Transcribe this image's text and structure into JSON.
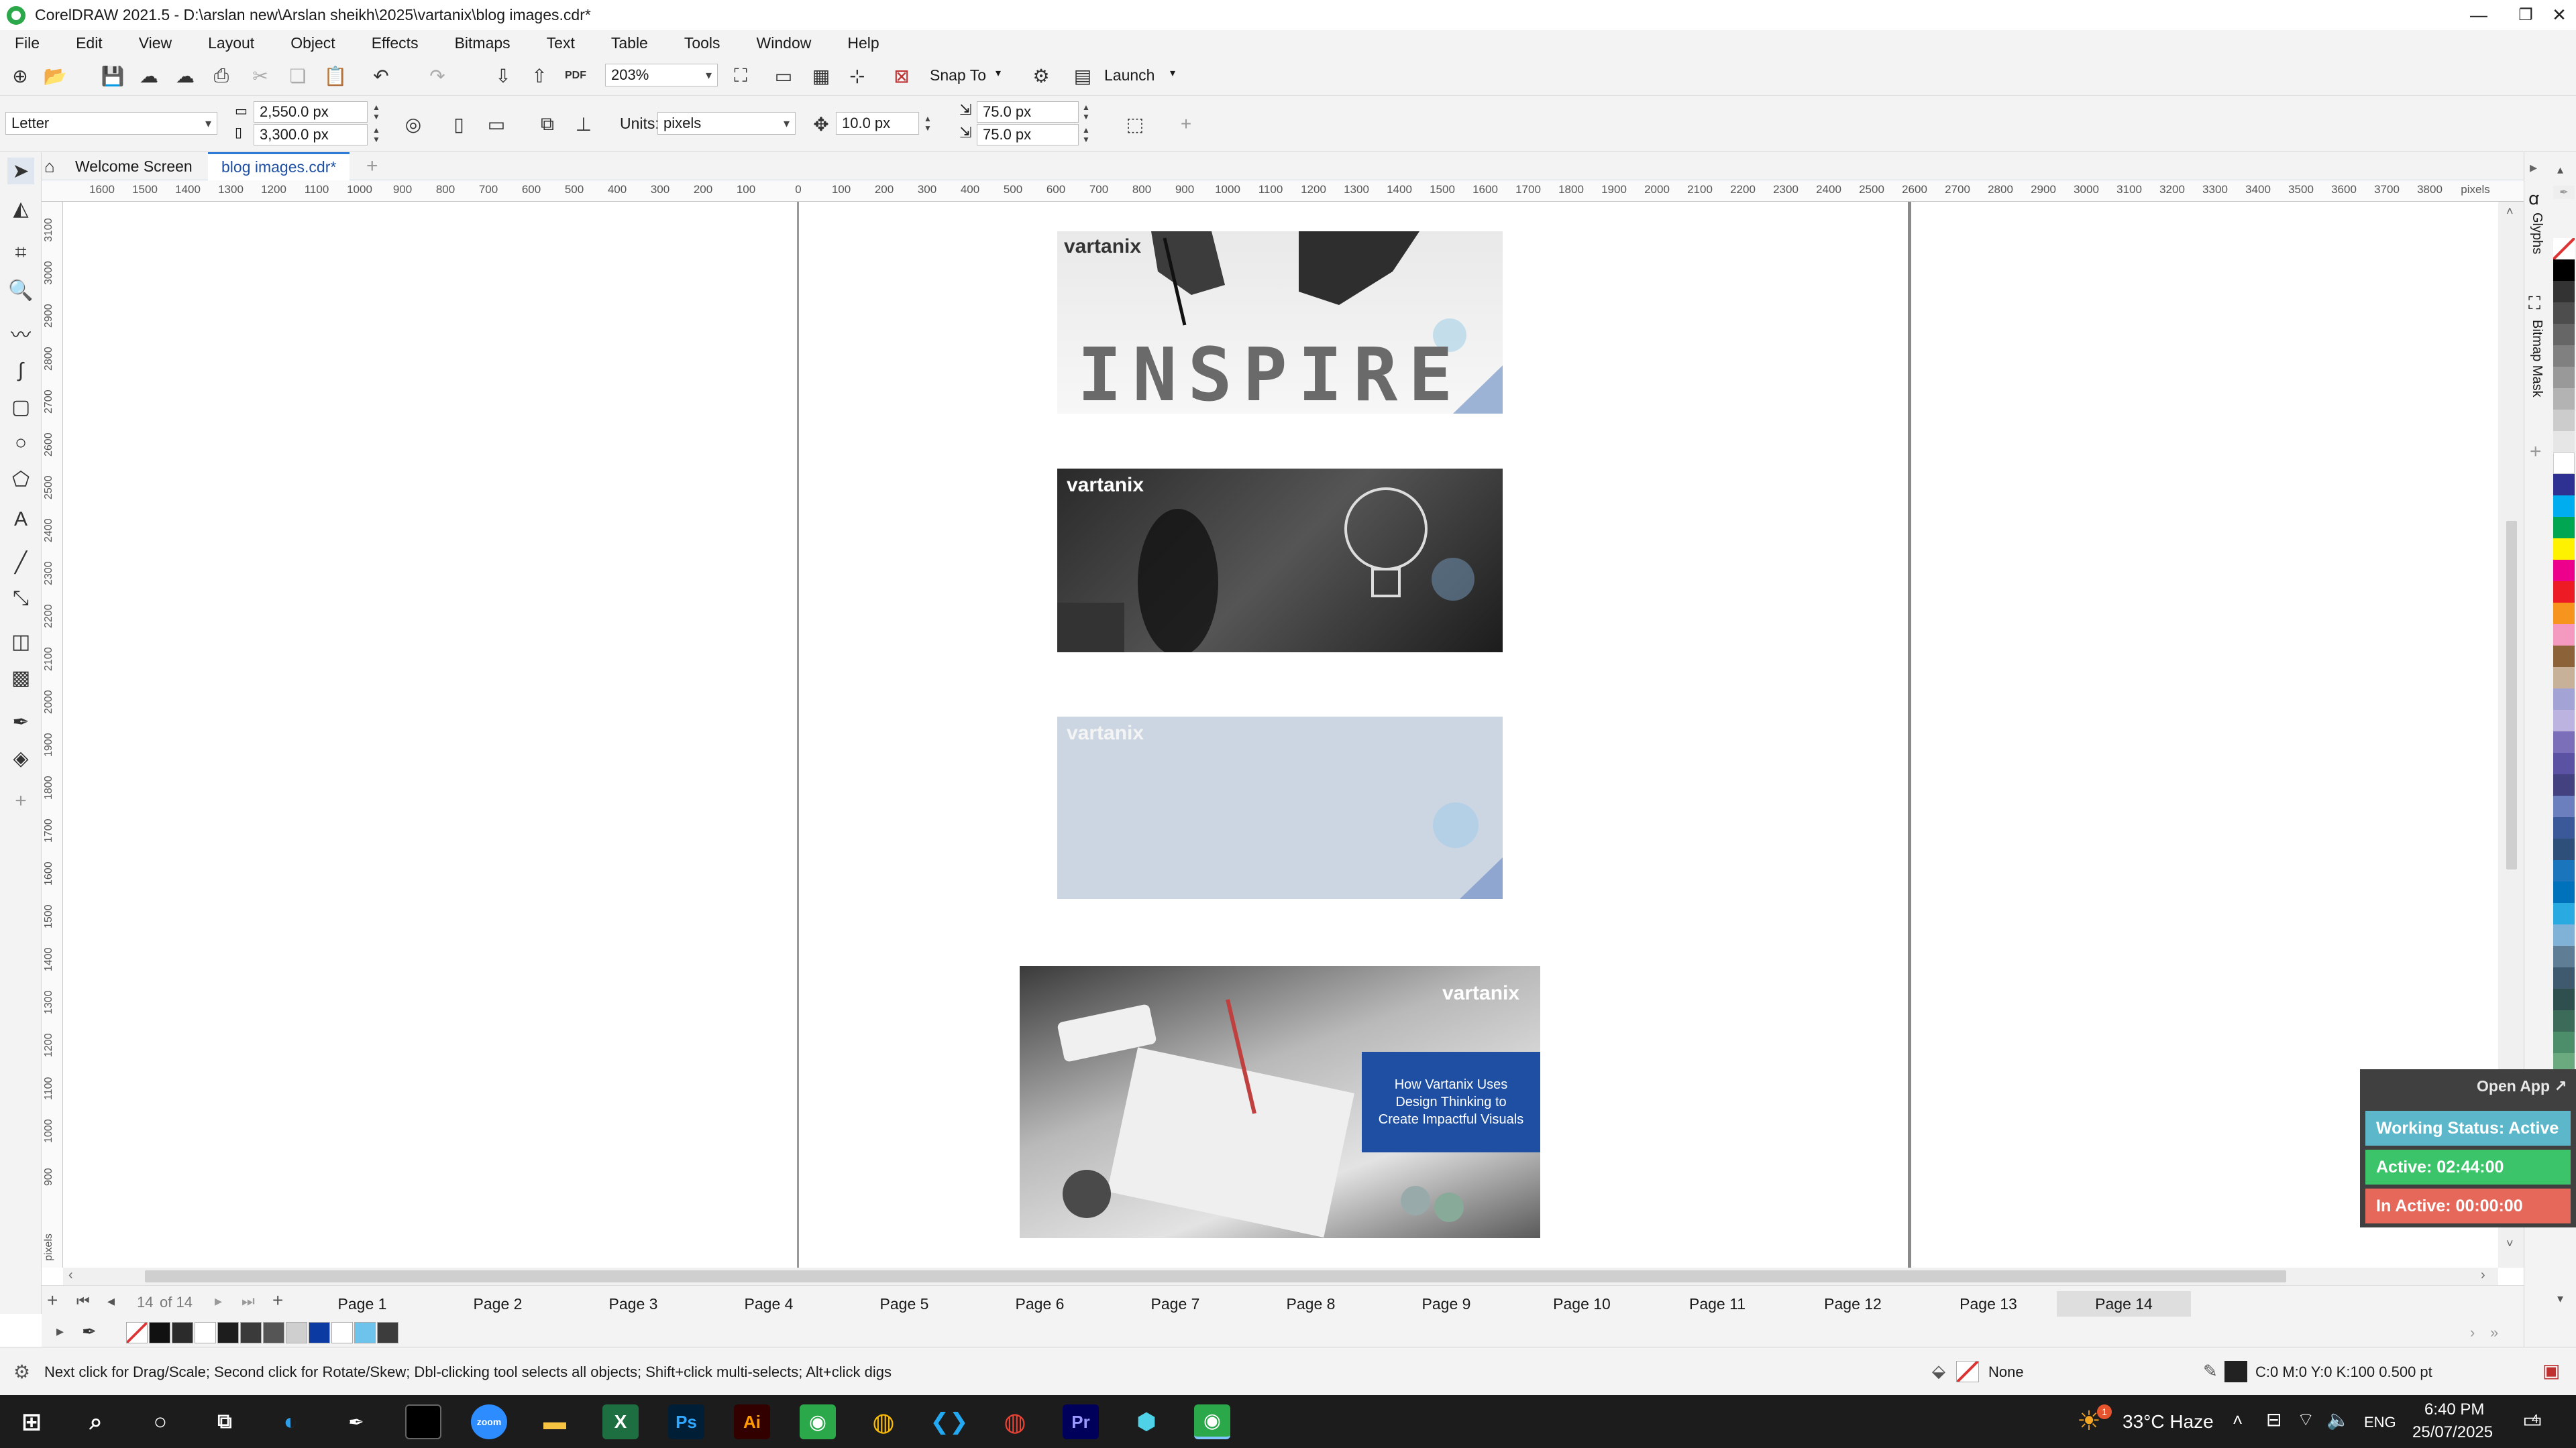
{
  "window": {
    "title": "CorelDRAW 2021.5 - D:\\arslan new\\Arslan sheikh\\2025\\vartanix\\blog images.cdr*"
  },
  "menu": [
    "File",
    "Edit",
    "View",
    "Layout",
    "Object",
    "Effects",
    "Bitmaps",
    "Text",
    "Table",
    "Tools",
    "Window",
    "Help"
  ],
  "toolbar": {
    "zoom": "203%",
    "snap_to": "Snap To",
    "launch": "Launch",
    "pdf_label": "PDF"
  },
  "properties": {
    "page_size": "Letter",
    "width": "2,550.0 px",
    "height": "3,300.0 px",
    "units_label": "Units:",
    "units": "pixels",
    "nudge": "10.0 px",
    "dup_x": "75.0 px",
    "dup_y": "75.0 px"
  },
  "tabs": {
    "welcome": "Welcome Screen",
    "document": "blog images.cdr*"
  },
  "ruler": {
    "h_labels": [
      "1600",
      "1500",
      "1400",
      "1300",
      "1200",
      "1100",
      "1000",
      "900",
      "800",
      "700",
      "600",
      "500",
      "400",
      "300",
      "200",
      "100",
      "0",
      "100",
      "200",
      "300",
      "400",
      "500",
      "600",
      "700",
      "800",
      "900",
      "1000",
      "1100",
      "1200",
      "1300",
      "1400",
      "1500",
      "1600",
      "1700",
      "1800",
      "1900",
      "2000",
      "2100",
      "2200",
      "2300",
      "2400",
      "2500",
      "2600",
      "2700",
      "2800",
      "2900",
      "3000",
      "3100",
      "3200",
      "3300",
      "3400",
      "3500",
      "3600",
      "3700",
      "3800"
    ],
    "h_unit": "pixels",
    "v_labels": [
      "3100",
      "3000",
      "2900",
      "2800",
      "2700",
      "2600",
      "2500",
      "2400",
      "2300",
      "2200",
      "2100",
      "2000",
      "1900",
      "1800",
      "1700",
      "1600",
      "1500",
      "1400",
      "1300",
      "1200",
      "1100",
      "1000",
      "900"
    ],
    "v_unit": "pixels"
  },
  "canvas": {
    "brand": "vartanix",
    "inspire_text": "INSPIRE",
    "blog_card": "How Vartanix Uses Design Thinking to Create Impactful Visuals"
  },
  "pages": {
    "current": "14",
    "of_label": "of 14",
    "tabs": [
      "Page 1",
      "Page 2",
      "Page 3",
      "Page 4",
      "Page 5",
      "Page 6",
      "Page 7",
      "Page 8",
      "Page 9",
      "Page 10",
      "Page 11",
      "Page 12",
      "Page 13",
      "Page 14"
    ],
    "active": "Page 14"
  },
  "status": {
    "hint": "Next click for Drag/Scale; Second click for Rotate/Skew; Dbl-clicking tool selects all objects; Shift+click multi-selects; Alt+click digs",
    "fill": "None",
    "outline": "C:0 M:0 Y:0 K:100  0.500 pt"
  },
  "dockers": {
    "glyphs": "Glyphs",
    "bitmap_mask": "Bitmap Mask"
  },
  "widget": {
    "open_app": "Open App ↗",
    "working": "Working Status: Active",
    "active": "Active: 02:44:00",
    "inactive": "In Active: 00:00:00"
  },
  "taskbar": {
    "weather": "33°C  Haze",
    "weather_badge": "1",
    "lang": "ENG",
    "time": "6:40 PM",
    "date": "25/07/2025",
    "notif": "4",
    "apps": [
      "zoom",
      "Ps",
      "Ai",
      "Pr"
    ]
  },
  "colors": {
    "accent_blue": "#1e4fa3",
    "widget_working": "#5bb7c9",
    "widget_active": "#3cc46a",
    "widget_inactive": "#e5685a"
  }
}
